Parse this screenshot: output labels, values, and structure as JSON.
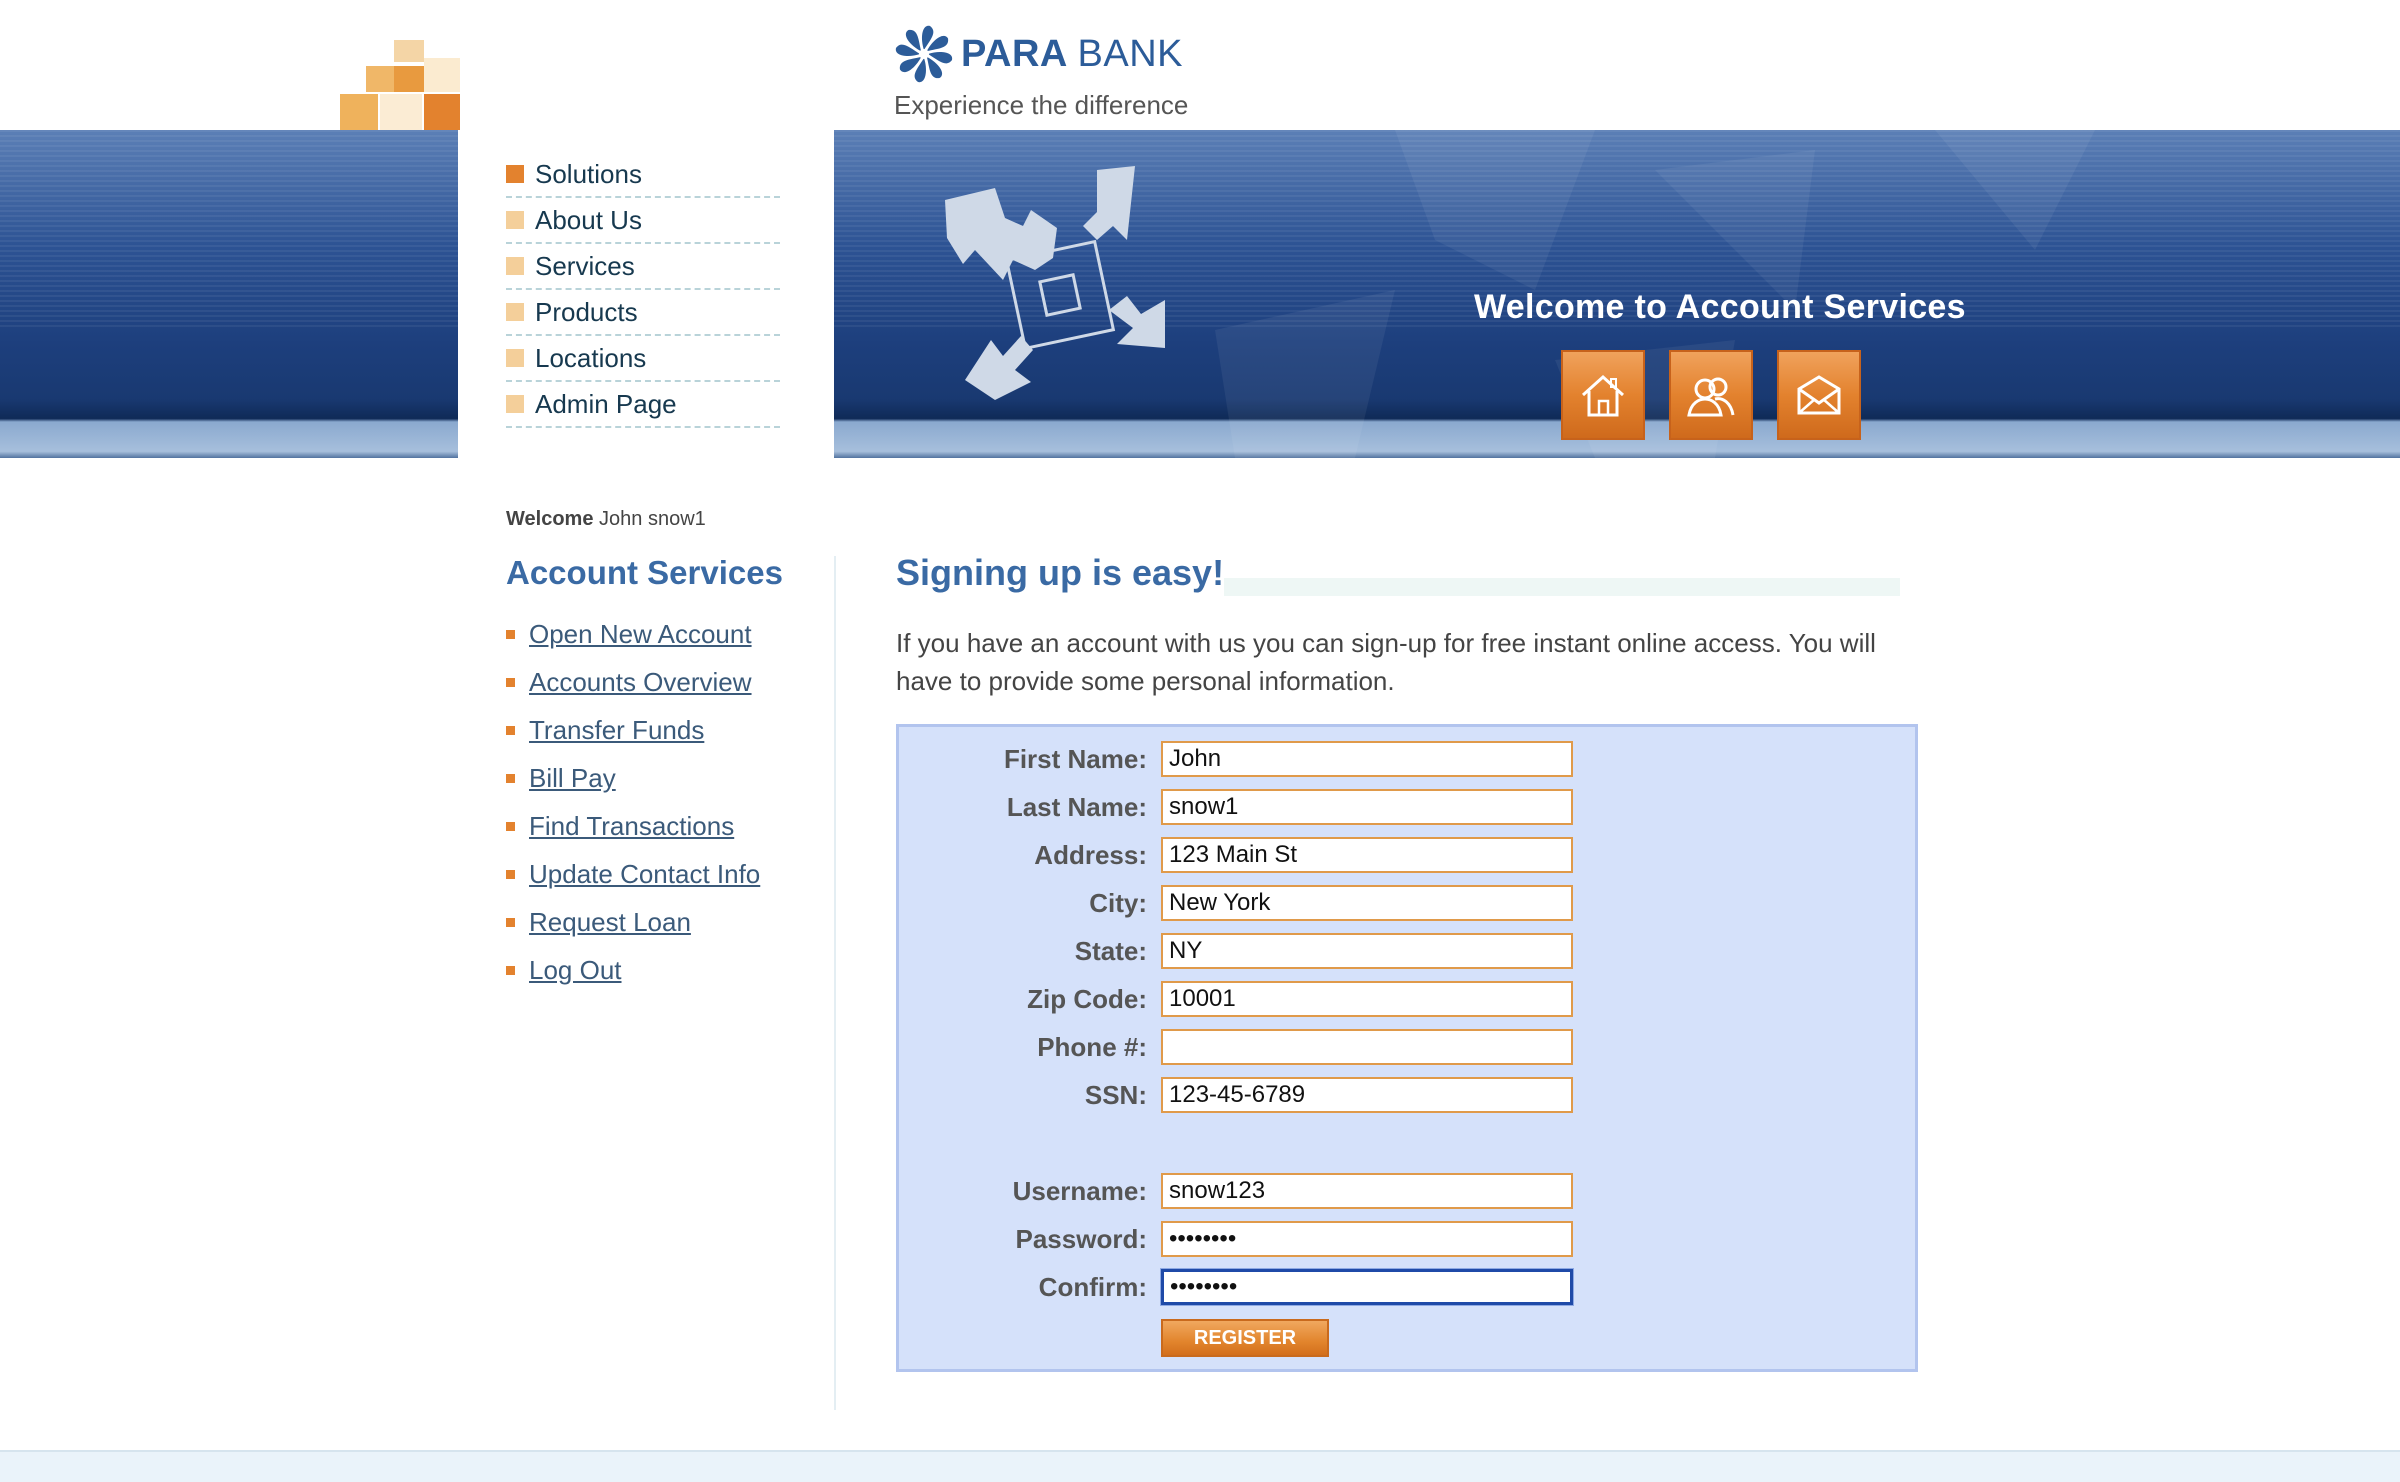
{
  "brand": {
    "name_bold": "PARA",
    "name_light": "BANK",
    "tagline": "Experience the difference"
  },
  "top_menu": [
    "Solutions",
    "About Us",
    "Services",
    "Products",
    "Locations",
    "Admin Page"
  ],
  "banner": {
    "title": "Welcome to Account Services",
    "icons": [
      "home-icon",
      "contact-icon",
      "mail-icon"
    ]
  },
  "sidebar": {
    "welcome_label": "Welcome",
    "welcome_name": "John snow1",
    "title": "Account Services",
    "links": [
      "Open New Account",
      "Accounts Overview",
      "Transfer Funds",
      "Bill Pay",
      "Find Transactions",
      "Update Contact Info",
      "Request Loan",
      "Log Out"
    ]
  },
  "main": {
    "title": "Signing up is easy!",
    "intro": "If you have an account with us you can sign-up for free instant online access. You will have to provide some personal information."
  },
  "form": {
    "first_name": {
      "label": "First Name:",
      "value": "John"
    },
    "last_name": {
      "label": "Last Name:",
      "value": "snow1"
    },
    "address": {
      "label": "Address:",
      "value": "123 Main St"
    },
    "city": {
      "label": "City:",
      "value": "New York"
    },
    "state": {
      "label": "State:",
      "value": "NY"
    },
    "zip": {
      "label": "Zip Code:",
      "value": "10001"
    },
    "phone": {
      "label": "Phone #:",
      "value": ""
    },
    "ssn": {
      "label": "SSN:",
      "value": "123-45-6789"
    },
    "username": {
      "label": "Username:",
      "value": "snow123"
    },
    "password": {
      "label": "Password:",
      "value": "••••••••"
    },
    "confirm": {
      "label": "Confirm:",
      "value": "••••••••"
    },
    "register_label": "REGISTER"
  },
  "colors": {
    "accent_orange": "#e3822e",
    "brand_blue": "#2c5c99",
    "form_bg": "#d5e1fa"
  }
}
